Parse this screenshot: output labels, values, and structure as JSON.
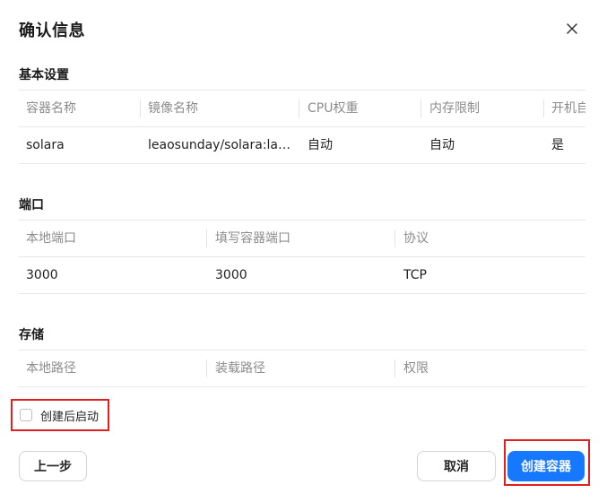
{
  "dialog": {
    "title": "确认信息"
  },
  "basic": {
    "title": "基本设置",
    "headers": [
      "容器名称",
      "镜像名称",
      "CPU权重",
      "内存限制",
      "开机自启"
    ],
    "row": [
      "solara",
      "leaosunday/solara:lat...",
      "自动",
      "自动",
      "是"
    ]
  },
  "ports": {
    "title": "端口",
    "headers": [
      "本地端口",
      "填写容器端口",
      "协议"
    ],
    "row": [
      "3000",
      "3000",
      "TCP"
    ]
  },
  "storage": {
    "title": "存储",
    "headers": [
      "本地路径",
      "装载路径",
      "权限"
    ]
  },
  "options": {
    "start_after_create": "创建后启动",
    "start_after_create_checked": false
  },
  "footer": {
    "prev_label": "上一步",
    "cancel_label": "取消",
    "create_label": "创建容器"
  },
  "colors": {
    "primary": "#1677ff",
    "highlight": "#e02020"
  },
  "icons": {
    "close": "close-icon"
  }
}
